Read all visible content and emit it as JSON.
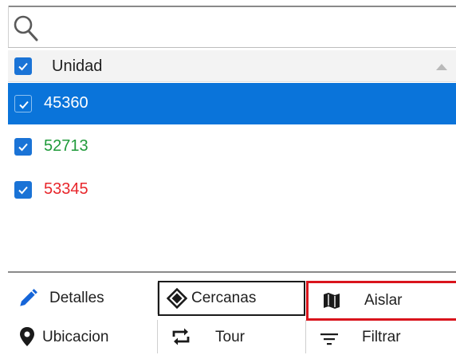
{
  "search": {
    "value": "",
    "placeholder": ""
  },
  "list": {
    "header_label": "Unidad",
    "rows": [
      {
        "label": "45360",
        "checked": true,
        "selected": true,
        "color": "#ffffff"
      },
      {
        "label": "52713",
        "checked": true,
        "selected": false,
        "color": "#1f9a3a"
      },
      {
        "label": "53345",
        "checked": true,
        "selected": false,
        "color": "#e8262b"
      }
    ]
  },
  "toolbar": {
    "details_label": "Detalles",
    "nearby_label": "Cercanas",
    "isolate_label": "Aislar",
    "location_label": "Ubicacion",
    "tour_label": "Tour",
    "filter_label": "Filtrar"
  },
  "colors": {
    "selection": "#0a74da",
    "checkbox": "#1a73d6",
    "highlight_border": "#d9141c",
    "details_icon": "#1565d8"
  }
}
